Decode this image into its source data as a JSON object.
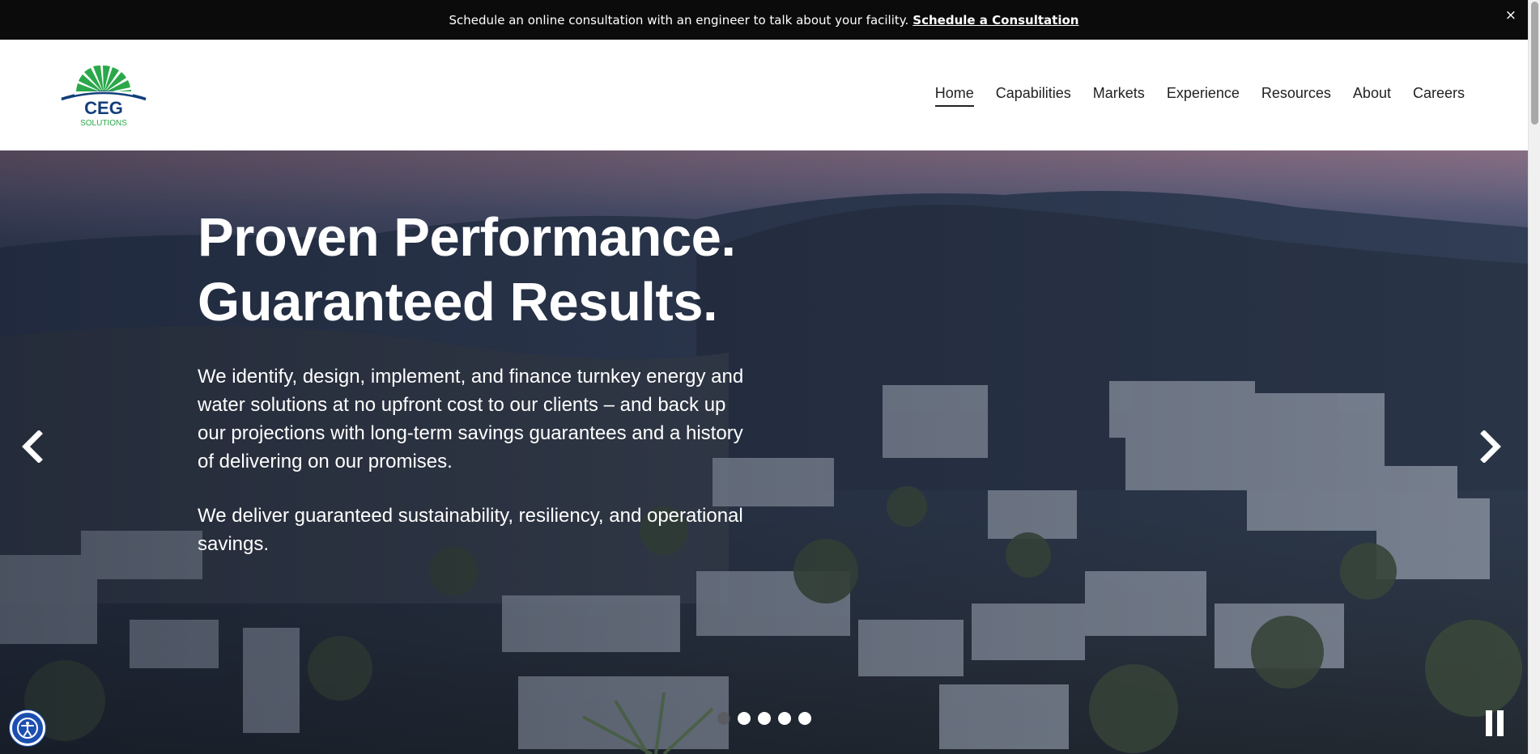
{
  "topbar": {
    "message": "Schedule an online consultation with an engineer to talk about your facility.",
    "cta": "Schedule a Consultation",
    "close": "×"
  },
  "header": {
    "logo": {
      "main": "CEG",
      "sub": "SOLUTIONS",
      "colors": {
        "green": "#2aa84a",
        "blue": "#123f7a"
      }
    },
    "nav": [
      {
        "label": "Home",
        "active": true
      },
      {
        "label": "Capabilities"
      },
      {
        "label": "Markets"
      },
      {
        "label": "Experience"
      },
      {
        "label": "Resources"
      },
      {
        "label": "About"
      },
      {
        "label": "Careers"
      }
    ]
  },
  "hero": {
    "title_line1": "Proven Performance.",
    "title_line2": "Guaranteed Results.",
    "paragraph1": "We identify, design, implement, and finance turnkey energy and water solutions at no upfront cost to our clients – and back up our projections with long-term savings guarantees and a history of delivering on our promises.",
    "paragraph2": "We deliver guaranteed sustainability, resiliency, and operational savings.",
    "slides_total": 5,
    "current_slide": 1,
    "icons": {
      "prev": "chevron-left-icon",
      "next": "chevron-right-icon",
      "pause": "pause-icon"
    }
  },
  "accessibility": {
    "icon": "accessibility-icon",
    "color": "#1d4fb0"
  }
}
